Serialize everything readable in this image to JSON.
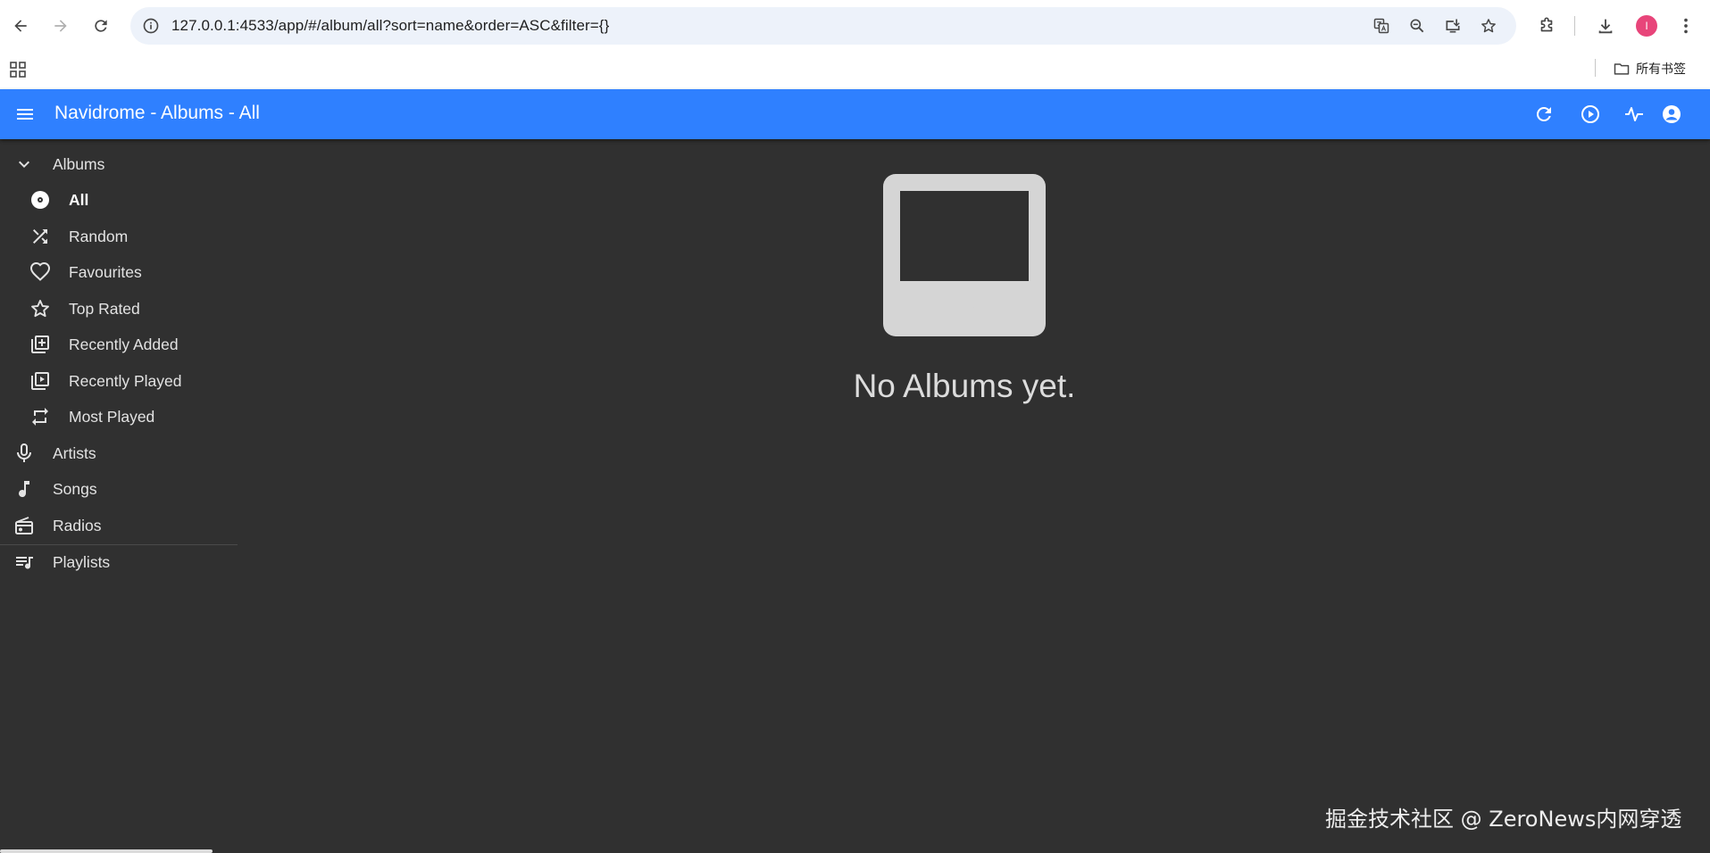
{
  "browser": {
    "url": "127.0.0.1:4533/app/#/album/all?sort=name&order=ASC&filter={}",
    "profile_initial": "I",
    "bookmarks_folder": "所有书签"
  },
  "app_bar": {
    "title": "Navidrome - Albums - All",
    "color": "#2f80ff"
  },
  "sidebar": {
    "albums_label": "Albums",
    "album_items": [
      {
        "label": "All",
        "icon": "album-icon",
        "active": true
      },
      {
        "label": "Random",
        "icon": "shuffle-icon"
      },
      {
        "label": "Favourites",
        "icon": "heart-icon"
      },
      {
        "label": "Top Rated",
        "icon": "star-icon"
      },
      {
        "label": "Recently Added",
        "icon": "library-add-icon"
      },
      {
        "label": "Recently Played",
        "icon": "video-library-icon"
      },
      {
        "label": "Most Played",
        "icon": "repeat-icon"
      }
    ],
    "items": [
      {
        "label": "Artists",
        "icon": "mic-icon"
      },
      {
        "label": "Songs",
        "icon": "music-note-icon"
      },
      {
        "label": "Radios",
        "icon": "radio-icon"
      },
      {
        "label": "Playlists",
        "icon": "queue-music-icon"
      }
    ]
  },
  "empty_state": {
    "message": "No Albums yet.",
    "icon": "inbox-icon"
  },
  "watermark": "掘金技术社区 @ ZeroNews内网穿透"
}
